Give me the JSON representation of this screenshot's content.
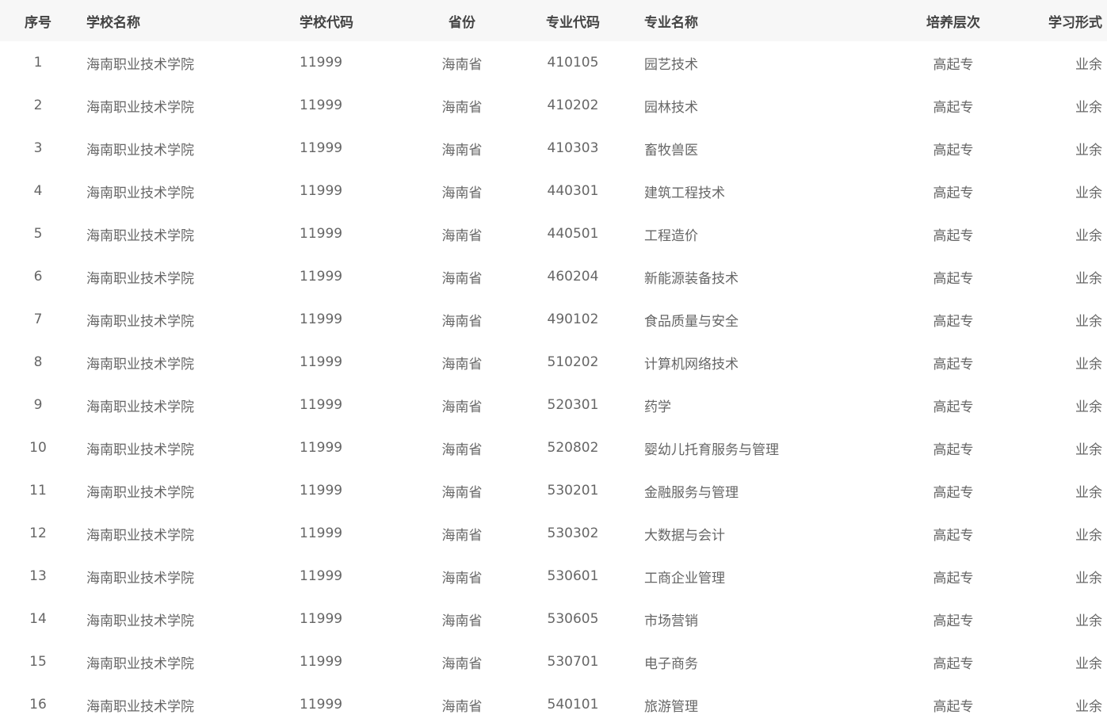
{
  "table": {
    "headers": {
      "seq": "序号",
      "school_name": "学校名称",
      "school_code": "学校代码",
      "province": "省份",
      "major_code": "专业代码",
      "major_name": "专业名称",
      "level": "培养层次",
      "study_form": "学习形式"
    },
    "rows": [
      {
        "seq": "1",
        "school_name": "海南职业技术学院",
        "school_code": "11999",
        "province": "海南省",
        "major_code": "410105",
        "major_name": "园艺技术",
        "level": "高起专",
        "study_form": "业余"
      },
      {
        "seq": "2",
        "school_name": "海南职业技术学院",
        "school_code": "11999",
        "province": "海南省",
        "major_code": "410202",
        "major_name": "园林技术",
        "level": "高起专",
        "study_form": "业余"
      },
      {
        "seq": "3",
        "school_name": "海南职业技术学院",
        "school_code": "11999",
        "province": "海南省",
        "major_code": "410303",
        "major_name": "畜牧兽医",
        "level": "高起专",
        "study_form": "业余"
      },
      {
        "seq": "4",
        "school_name": "海南职业技术学院",
        "school_code": "11999",
        "province": "海南省",
        "major_code": "440301",
        "major_name": "建筑工程技术",
        "level": "高起专",
        "study_form": "业余"
      },
      {
        "seq": "5",
        "school_name": "海南职业技术学院",
        "school_code": "11999",
        "province": "海南省",
        "major_code": "440501",
        "major_name": "工程造价",
        "level": "高起专",
        "study_form": "业余"
      },
      {
        "seq": "6",
        "school_name": "海南职业技术学院",
        "school_code": "11999",
        "province": "海南省",
        "major_code": "460204",
        "major_name": "新能源装备技术",
        "level": "高起专",
        "study_form": "业余"
      },
      {
        "seq": "7",
        "school_name": "海南职业技术学院",
        "school_code": "11999",
        "province": "海南省",
        "major_code": "490102",
        "major_name": "食品质量与安全",
        "level": "高起专",
        "study_form": "业余"
      },
      {
        "seq": "8",
        "school_name": "海南职业技术学院",
        "school_code": "11999",
        "province": "海南省",
        "major_code": "510202",
        "major_name": "计算机网络技术",
        "level": "高起专",
        "study_form": "业余"
      },
      {
        "seq": "9",
        "school_name": "海南职业技术学院",
        "school_code": "11999",
        "province": "海南省",
        "major_code": "520301",
        "major_name": "药学",
        "level": "高起专",
        "study_form": "业余"
      },
      {
        "seq": "10",
        "school_name": "海南职业技术学院",
        "school_code": "11999",
        "province": "海南省",
        "major_code": "520802",
        "major_name": "婴幼儿托育服务与管理",
        "level": "高起专",
        "study_form": "业余"
      },
      {
        "seq": "11",
        "school_name": "海南职业技术学院",
        "school_code": "11999",
        "province": "海南省",
        "major_code": "530201",
        "major_name": "金融服务与管理",
        "level": "高起专",
        "study_form": "业余"
      },
      {
        "seq": "12",
        "school_name": "海南职业技术学院",
        "school_code": "11999",
        "province": "海南省",
        "major_code": "530302",
        "major_name": "大数据与会计",
        "level": "高起专",
        "study_form": "业余"
      },
      {
        "seq": "13",
        "school_name": "海南职业技术学院",
        "school_code": "11999",
        "province": "海南省",
        "major_code": "530601",
        "major_name": "工商企业管理",
        "level": "高起专",
        "study_form": "业余"
      },
      {
        "seq": "14",
        "school_name": "海南职业技术学院",
        "school_code": "11999",
        "province": "海南省",
        "major_code": "530605",
        "major_name": "市场营销",
        "level": "高起专",
        "study_form": "业余"
      },
      {
        "seq": "15",
        "school_name": "海南职业技术学院",
        "school_code": "11999",
        "province": "海南省",
        "major_code": "530701",
        "major_name": "电子商务",
        "level": "高起专",
        "study_form": "业余"
      },
      {
        "seq": "16",
        "school_name": "海南职业技术学院",
        "school_code": "11999",
        "province": "海南省",
        "major_code": "540101",
        "major_name": "旅游管理",
        "level": "高起专",
        "study_form": "业余"
      }
    ]
  }
}
